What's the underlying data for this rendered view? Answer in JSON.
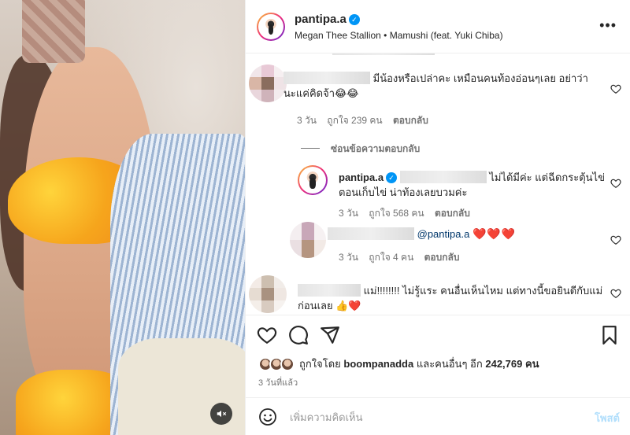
{
  "post": {
    "username": "pantipa.a",
    "verified_mark": "✓",
    "audio": "Megan Thee Stallion • Mamushi (feat. Yuki Chiba)",
    "more_icon": "more-horizontal-icon"
  },
  "comments": [
    {
      "text": "มีน้องหรือเปล่าคะ เหมือนคนท้องอ่อนๆเลย อย่าว่านะแค่คิดจ้า😂😂",
      "time": "3 วัน",
      "likes": "ถูกใจ 239 คน",
      "reply": "ตอบกลับ"
    }
  ],
  "hide_replies": "ซ่อนข้อความตอบกลับ",
  "replies": [
    {
      "username": "pantipa.a",
      "text": "ไม่ได้มีค่ะ แต่ฉีดกระตุ้นไข่ตอนเก็บไข่ น่าท้องเลยบวมค่ะ",
      "time": "3 วัน",
      "likes": "ถูกใจ 568 คน",
      "reply": "ตอบกลับ"
    },
    {
      "mention": "@pantipa.a",
      "hearts": "❤️❤️❤️",
      "time": "3 วัน",
      "likes": "ถูกใจ 4 คน",
      "reply": "ตอบกลับ"
    }
  ],
  "last_comment": {
    "text": "แม่!!!!!!!! ไม่รู้แระ คนอื่นเห็นไหม แต่ทางนี้ขอยินดีกับแม่ก่อนเลย 👍❤️"
  },
  "likes_line": {
    "prefix": "ถูกใจโดย",
    "liker": "boompanadda",
    "middle": "และคนอื่นๆ อีก",
    "count": "242,769 คน"
  },
  "time_ago": "3 วันที่แล้ว",
  "composer": {
    "placeholder": "เพิ่มความคิดเห็น",
    "post_label": "โพสต์"
  },
  "colors": {
    "accent": "#0095f6",
    "post_disabled": "#b2dffc",
    "heart_red": "#e0245e"
  }
}
